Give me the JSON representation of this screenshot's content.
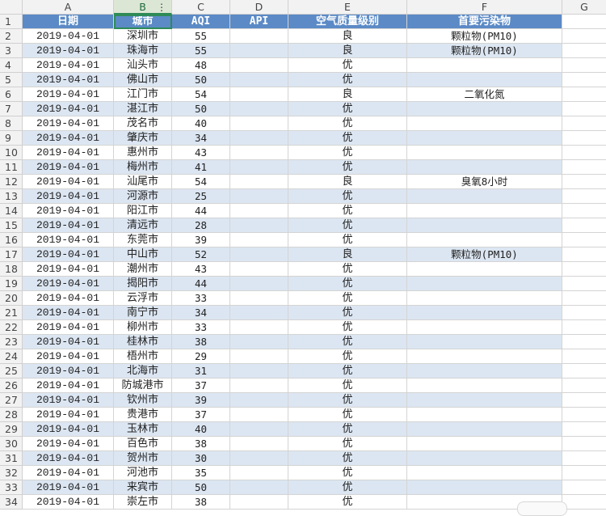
{
  "columns": [
    "A",
    "B",
    "C",
    "D",
    "E",
    "F",
    "G"
  ],
  "header": {
    "row_number": "1",
    "date": "日期",
    "city": "城市",
    "aqi": "AQI",
    "api": "API",
    "quality": "空气质量级别",
    "pollutant": "首要污染物"
  },
  "active_cell": "B1",
  "rows": [
    {
      "n": "2",
      "date": "2019-04-01",
      "city": "深圳市",
      "aqi": "55",
      "api": "",
      "quality": "良",
      "pollutant": "颗粒物(PM10)"
    },
    {
      "n": "3",
      "date": "2019-04-01",
      "city": "珠海市",
      "aqi": "55",
      "api": "",
      "quality": "良",
      "pollutant": "颗粒物(PM10)"
    },
    {
      "n": "4",
      "date": "2019-04-01",
      "city": "汕头市",
      "aqi": "48",
      "api": "",
      "quality": "优",
      "pollutant": ""
    },
    {
      "n": "5",
      "date": "2019-04-01",
      "city": "佛山市",
      "aqi": "50",
      "api": "",
      "quality": "优",
      "pollutant": ""
    },
    {
      "n": "6",
      "date": "2019-04-01",
      "city": "江门市",
      "aqi": "54",
      "api": "",
      "quality": "良",
      "pollutant": "二氧化氮"
    },
    {
      "n": "7",
      "date": "2019-04-01",
      "city": "湛江市",
      "aqi": "50",
      "api": "",
      "quality": "优",
      "pollutant": ""
    },
    {
      "n": "8",
      "date": "2019-04-01",
      "city": "茂名市",
      "aqi": "40",
      "api": "",
      "quality": "优",
      "pollutant": ""
    },
    {
      "n": "9",
      "date": "2019-04-01",
      "city": "肇庆市",
      "aqi": "34",
      "api": "",
      "quality": "优",
      "pollutant": ""
    },
    {
      "n": "10",
      "date": "2019-04-01",
      "city": "惠州市",
      "aqi": "43",
      "api": "",
      "quality": "优",
      "pollutant": ""
    },
    {
      "n": "11",
      "date": "2019-04-01",
      "city": "梅州市",
      "aqi": "41",
      "api": "",
      "quality": "优",
      "pollutant": ""
    },
    {
      "n": "12",
      "date": "2019-04-01",
      "city": "汕尾市",
      "aqi": "54",
      "api": "",
      "quality": "良",
      "pollutant": "臭氧8小时"
    },
    {
      "n": "13",
      "date": "2019-04-01",
      "city": "河源市",
      "aqi": "25",
      "api": "",
      "quality": "优",
      "pollutant": ""
    },
    {
      "n": "14",
      "date": "2019-04-01",
      "city": "阳江市",
      "aqi": "44",
      "api": "",
      "quality": "优",
      "pollutant": ""
    },
    {
      "n": "15",
      "date": "2019-04-01",
      "city": "清远市",
      "aqi": "28",
      "api": "",
      "quality": "优",
      "pollutant": ""
    },
    {
      "n": "16",
      "date": "2019-04-01",
      "city": "东莞市",
      "aqi": "39",
      "api": "",
      "quality": "优",
      "pollutant": ""
    },
    {
      "n": "17",
      "date": "2019-04-01",
      "city": "中山市",
      "aqi": "52",
      "api": "",
      "quality": "良",
      "pollutant": "颗粒物(PM10)"
    },
    {
      "n": "18",
      "date": "2019-04-01",
      "city": "潮州市",
      "aqi": "43",
      "api": "",
      "quality": "优",
      "pollutant": ""
    },
    {
      "n": "19",
      "date": "2019-04-01",
      "city": "揭阳市",
      "aqi": "44",
      "api": "",
      "quality": "优",
      "pollutant": ""
    },
    {
      "n": "20",
      "date": "2019-04-01",
      "city": "云浮市",
      "aqi": "33",
      "api": "",
      "quality": "优",
      "pollutant": ""
    },
    {
      "n": "21",
      "date": "2019-04-01",
      "city": "南宁市",
      "aqi": "34",
      "api": "",
      "quality": "优",
      "pollutant": ""
    },
    {
      "n": "22",
      "date": "2019-04-01",
      "city": "柳州市",
      "aqi": "33",
      "api": "",
      "quality": "优",
      "pollutant": ""
    },
    {
      "n": "23",
      "date": "2019-04-01",
      "city": "桂林市",
      "aqi": "38",
      "api": "",
      "quality": "优",
      "pollutant": ""
    },
    {
      "n": "24",
      "date": "2019-04-01",
      "city": "梧州市",
      "aqi": "29",
      "api": "",
      "quality": "优",
      "pollutant": ""
    },
    {
      "n": "25",
      "date": "2019-04-01",
      "city": "北海市",
      "aqi": "31",
      "api": "",
      "quality": "优",
      "pollutant": ""
    },
    {
      "n": "26",
      "date": "2019-04-01",
      "city": "防城港市",
      "aqi": "37",
      "api": "",
      "quality": "优",
      "pollutant": ""
    },
    {
      "n": "27",
      "date": "2019-04-01",
      "city": "钦州市",
      "aqi": "39",
      "api": "",
      "quality": "优",
      "pollutant": ""
    },
    {
      "n": "28",
      "date": "2019-04-01",
      "city": "贵港市",
      "aqi": "37",
      "api": "",
      "quality": "优",
      "pollutant": ""
    },
    {
      "n": "29",
      "date": "2019-04-01",
      "city": "玉林市",
      "aqi": "40",
      "api": "",
      "quality": "优",
      "pollutant": ""
    },
    {
      "n": "30",
      "date": "2019-04-01",
      "city": "百色市",
      "aqi": "38",
      "api": "",
      "quality": "优",
      "pollutant": ""
    },
    {
      "n": "31",
      "date": "2019-04-01",
      "city": "贺州市",
      "aqi": "30",
      "api": "",
      "quality": "优",
      "pollutant": ""
    },
    {
      "n": "32",
      "date": "2019-04-01",
      "city": "河池市",
      "aqi": "35",
      "api": "",
      "quality": "优",
      "pollutant": ""
    },
    {
      "n": "33",
      "date": "2019-04-01",
      "city": "来宾市",
      "aqi": "50",
      "api": "",
      "quality": "优",
      "pollutant": ""
    },
    {
      "n": "34",
      "date": "2019-04-01",
      "city": "崇左市",
      "aqi": "38",
      "api": "",
      "quality": "优",
      "pollutant": ""
    }
  ],
  "colors": {
    "header_fill": "#5b8ac6",
    "band_fill": "#dce6f2",
    "selection": "#2e8b57",
    "gridline": "#d4d4d4"
  },
  "icons": {
    "column_menu": "more-vertical-icon"
  }
}
